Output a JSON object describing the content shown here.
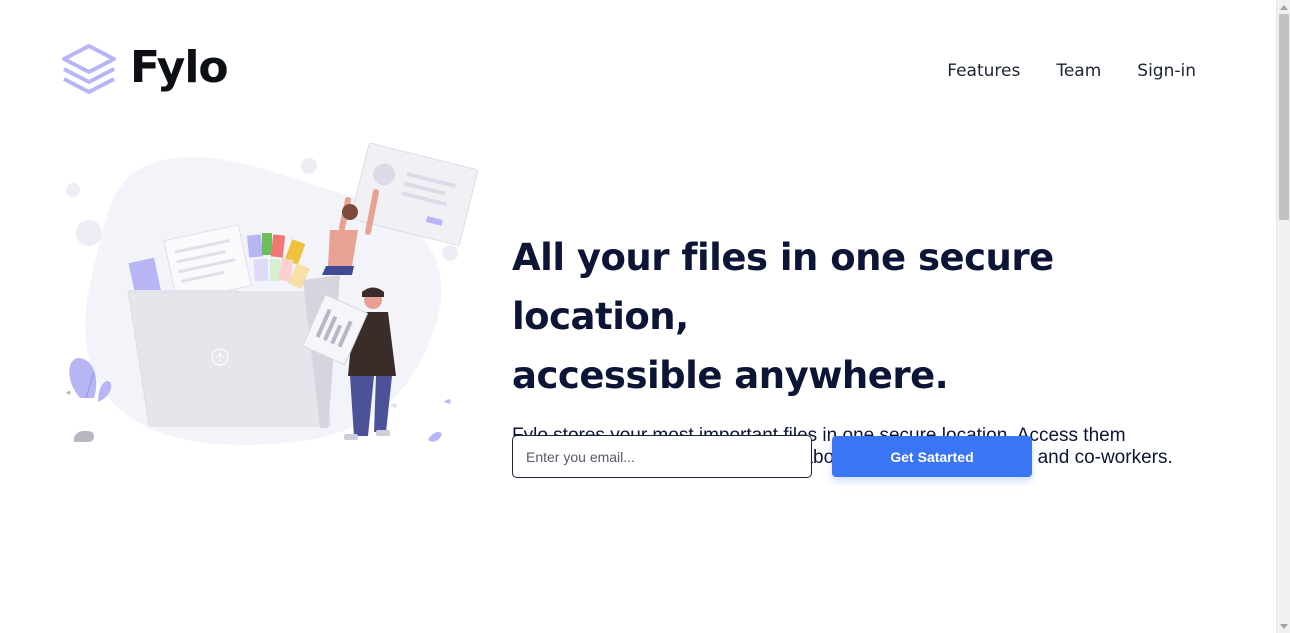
{
  "brand": {
    "name": "Fylo",
    "logo_icon": "stack-layers-icon",
    "accent_color": "#3a76f4",
    "logo_color": "#b8b5f5"
  },
  "nav": {
    "items": [
      {
        "label": "Features"
      },
      {
        "label": "Team"
      },
      {
        "label": "Sign-in"
      }
    ]
  },
  "hero": {
    "title_line1": "All your files in one secure location,",
    "title_line2": "accessible anywhere.",
    "description": "Fylo stores your most important files in one secure location. Access them wherever you need, share and collaborate with friends, family, and co-workers.",
    "illustration": "people-organizing-files-illustration"
  },
  "signup": {
    "email_placeholder": "Enter you email...",
    "email_value": "",
    "button_label": "Get Satarted"
  }
}
